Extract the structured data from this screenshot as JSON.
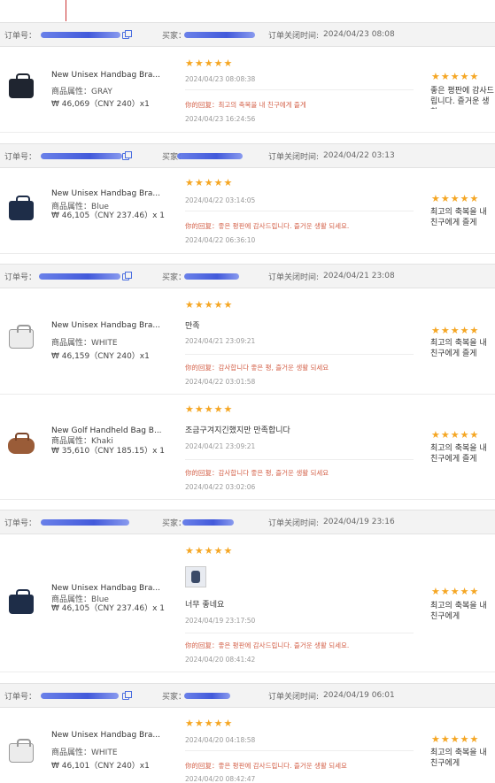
{
  "labels": {
    "order_no": "订单号：",
    "buyer": "买家：",
    "close_time_prefix": "订单关闭时间:",
    "attr_prefix": "商品属性：",
    "reply_prefix": "你的回复："
  },
  "orders": [
    {
      "close_time": "2024/04/23 08:08",
      "items": [
        {
          "name": "New Unisex Handbag Bra...",
          "attr": "GRAY",
          "price": "₩ 46,069（CNY  240）x1",
          "stars": "★★★★★",
          "comment": "",
          "comment_date": "2024/04/23 08:08:38",
          "reply": "최고의 축복을 내 친구에게 즐게",
          "reply_date": "2024/04/23 16:24:56",
          "right_text": "좋은 평판에 감사드립니다. 즐거운 생활"
        }
      ]
    },
    {
      "close_time": "2024/04/22 03:13",
      "items": [
        {
          "name": "New Unisex Handbag Bra...",
          "attr": "Blue",
          "price": "₩ 46,105（CNY  237.46）x 1",
          "stars": "★★★★★",
          "comment": "",
          "comment_date": "2024/04/22 03:14:05",
          "reply": "좋은 평판에 감사드립니다. 즐거운 생활 되세요.",
          "reply_date": "2024/04/22 06:36:10",
          "right_text": "최고의 축복을 내 친구에게 즐게"
        }
      ]
    },
    {
      "close_time": "2024/04/21 23:08",
      "items": [
        {
          "name": "New Unisex Handbag Bra...",
          "attr": "WHITE",
          "price": "₩ 46,159（CNY  240）x1",
          "stars": "★★★★★",
          "comment": "만족",
          "comment_date": "2024/04/21 23:09:21",
          "reply": "감사합니다 좋은 평, 즐거운 생활 되세요",
          "reply_date": "2024/04/22 03:01:58",
          "right_text": "최고의 축복을 내 친구에게 즐게"
        },
        {
          "name": "New Golf Handheld Bag B...",
          "attr": "Khaki",
          "price": "₩ 35,610（CNY  185.15）x 1",
          "stars": "★★★★★",
          "comment": "조금구겨지긴했지만 만족합니다",
          "comment_date": "2024/04/21 23:09:21",
          "reply": "감사합니다 좋은 평, 즐거운 생활 되세요",
          "reply_date": "2024/04/22 03:02:06",
          "right_text": "최고의 축복을 내 친구에게 즐게"
        }
      ]
    },
    {
      "close_time": "2024/04/19 23:16",
      "items": [
        {
          "name": "New Unisex Handbag Bra...",
          "attr": "Blue",
          "price": "₩ 46,105（CNY  237.46）x 1",
          "stars": "★★★★★",
          "comment": "너무 좋네요",
          "comment_date": "2024/04/19 23:17:50",
          "reply": "좋은 평판에 감사드립니다. 즐거운 생활 되세요.",
          "reply_date": "2024/04/20 08:41:42",
          "right_text": "최고의 축복을 내 친구에게"
        }
      ]
    },
    {
      "close_time": "2024/04/19 06:01",
      "items": [
        {
          "name": "New Unisex Handbag Bra...",
          "attr": "WHITE",
          "price": "₩ 46,101（CNY  240）x1",
          "stars": "★★★★★",
          "comment": "",
          "comment_date": "2024/04/20 04:18:58",
          "reply": "좋은 평판에 감사드립니다. 즐거운 생활 되세요",
          "reply_date": "2024/04/20 08:42:47",
          "right_text": "최고의 축복을 내 친구에게"
        }
      ]
    }
  ]
}
